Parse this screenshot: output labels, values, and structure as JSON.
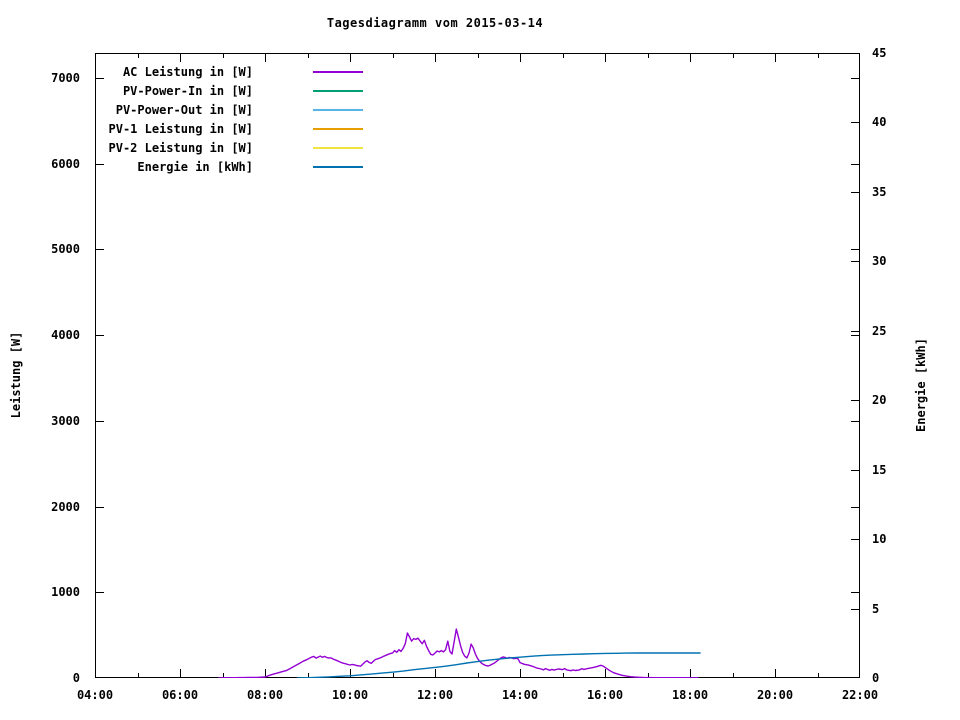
{
  "colors": {
    "text": "#000000",
    "background": "#ffffff",
    "border": "#000000"
  },
  "chart_data": {
    "type": "line",
    "title": "Tagesdiagramm vom 2015-03-14",
    "grid": false,
    "legend_position": "top-left-inside",
    "x_axis": {
      "label": "",
      "range_hours": [
        4,
        22
      ],
      "major_ticks": [
        {
          "hour": 4,
          "label": "04:00"
        },
        {
          "hour": 6,
          "label": "06:00"
        },
        {
          "hour": 8,
          "label": "08:00"
        },
        {
          "hour": 10,
          "label": "10:00"
        },
        {
          "hour": 12,
          "label": "12:00"
        },
        {
          "hour": 14,
          "label": "14:00"
        },
        {
          "hour": 16,
          "label": "16:00"
        },
        {
          "hour": 18,
          "label": "18:00"
        },
        {
          "hour": 20,
          "label": "20:00"
        },
        {
          "hour": 22,
          "label": "22:00"
        }
      ],
      "minor_tick_hours": [
        5,
        7,
        9,
        11,
        13,
        15,
        17,
        19,
        21
      ]
    },
    "y1_axis": {
      "label": "Leistung [W]",
      "range": [
        0,
        7292
      ],
      "ticks": [
        0,
        1000,
        2000,
        3000,
        4000,
        5000,
        6000,
        7000
      ]
    },
    "y2_axis": {
      "label": "Energie [kWh]",
      "range": [
        0,
        45
      ],
      "ticks": [
        0,
        5,
        10,
        15,
        20,
        25,
        30,
        35,
        40,
        45
      ]
    },
    "series": [
      {
        "name": "AC Leistung in [W]",
        "color": "#9400d3",
        "axis": "y1",
        "points": [
          [
            6.9,
            0
          ],
          [
            7.0,
            2
          ],
          [
            7.1,
            3
          ],
          [
            7.2,
            4
          ],
          [
            7.3,
            4
          ],
          [
            7.4,
            5
          ],
          [
            7.5,
            5
          ],
          [
            7.6,
            6
          ],
          [
            7.7,
            6
          ],
          [
            7.8,
            7
          ],
          [
            7.9,
            9
          ],
          [
            8.0,
            12
          ],
          [
            8.05,
            20
          ],
          [
            8.1,
            30
          ],
          [
            8.2,
            46
          ],
          [
            8.3,
            60
          ],
          [
            8.4,
            73
          ],
          [
            8.5,
            86
          ],
          [
            8.6,
            112
          ],
          [
            8.7,
            140
          ],
          [
            8.8,
            168
          ],
          [
            8.9,
            196
          ],
          [
            9.0,
            218
          ],
          [
            9.05,
            232
          ],
          [
            9.1,
            244
          ],
          [
            9.15,
            252
          ],
          [
            9.2,
            232
          ],
          [
            9.25,
            244
          ],
          [
            9.3,
            256
          ],
          [
            9.35,
            242
          ],
          [
            9.4,
            252
          ],
          [
            9.45,
            240
          ],
          [
            9.5,
            232
          ],
          [
            9.55,
            236
          ],
          [
            9.6,
            222
          ],
          [
            9.65,
            212
          ],
          [
            9.7,
            202
          ],
          [
            9.75,
            190
          ],
          [
            9.8,
            180
          ],
          [
            9.85,
            172
          ],
          [
            9.9,
            166
          ],
          [
            9.95,
            158
          ],
          [
            10.0,
            152
          ],
          [
            10.05,
            158
          ],
          [
            10.1,
            154
          ],
          [
            10.15,
            146
          ],
          [
            10.2,
            142
          ],
          [
            10.25,
            138
          ],
          [
            10.3,
            162
          ],
          [
            10.35,
            186
          ],
          [
            10.4,
            202
          ],
          [
            10.45,
            182
          ],
          [
            10.5,
            172
          ],
          [
            10.55,
            196
          ],
          [
            10.6,
            216
          ],
          [
            10.65,
            224
          ],
          [
            10.7,
            232
          ],
          [
            10.75,
            244
          ],
          [
            10.8,
            256
          ],
          [
            10.85,
            266
          ],
          [
            10.9,
            276
          ],
          [
            10.95,
            286
          ],
          [
            11.0,
            290
          ],
          [
            11.05,
            320
          ],
          [
            11.1,
            300
          ],
          [
            11.15,
            330
          ],
          [
            11.2,
            310
          ],
          [
            11.25,
            345
          ],
          [
            11.3,
            400
          ],
          [
            11.35,
            525
          ],
          [
            11.4,
            480
          ],
          [
            11.45,
            430
          ],
          [
            11.5,
            460
          ],
          [
            11.55,
            450
          ],
          [
            11.6,
            465
          ],
          [
            11.65,
            430
          ],
          [
            11.7,
            400
          ],
          [
            11.75,
            440
          ],
          [
            11.8,
            370
          ],
          [
            11.85,
            320
          ],
          [
            11.9,
            275
          ],
          [
            11.95,
            270
          ],
          [
            12.0,
            290
          ],
          [
            12.05,
            315
          ],
          [
            12.1,
            305
          ],
          [
            12.15,
            320
          ],
          [
            12.2,
            305
          ],
          [
            12.25,
            330
          ],
          [
            12.3,
            430
          ],
          [
            12.35,
            310
          ],
          [
            12.4,
            280
          ],
          [
            12.45,
            420
          ],
          [
            12.5,
            570
          ],
          [
            12.55,
            480
          ],
          [
            12.6,
            380
          ],
          [
            12.65,
            300
          ],
          [
            12.7,
            255
          ],
          [
            12.75,
            235
          ],
          [
            12.8,
            290
          ],
          [
            12.85,
            395
          ],
          [
            12.9,
            350
          ],
          [
            12.95,
            280
          ],
          [
            13.0,
            230
          ],
          [
            13.05,
            195
          ],
          [
            13.1,
            170
          ],
          [
            13.15,
            155
          ],
          [
            13.2,
            145
          ],
          [
            13.25,
            140
          ],
          [
            13.3,
            150
          ],
          [
            13.4,
            175
          ],
          [
            13.5,
            215
          ],
          [
            13.55,
            235
          ],
          [
            13.6,
            245
          ],
          [
            13.65,
            240
          ],
          [
            13.7,
            230
          ],
          [
            13.75,
            240
          ],
          [
            13.8,
            235
          ],
          [
            13.85,
            225
          ],
          [
            13.9,
            230
          ],
          [
            13.95,
            225
          ],
          [
            14.0,
            180
          ],
          [
            14.1,
            160
          ],
          [
            14.2,
            150
          ],
          [
            14.3,
            135
          ],
          [
            14.4,
            115
          ],
          [
            14.5,
            105
          ],
          [
            14.55,
            95
          ],
          [
            14.6,
            110
          ],
          [
            14.7,
            90
          ],
          [
            14.75,
            100
          ],
          [
            14.8,
            92
          ],
          [
            14.9,
            105
          ],
          [
            15.0,
            98
          ],
          [
            15.05,
            110
          ],
          [
            15.1,
            95
          ],
          [
            15.2,
            85
          ],
          [
            15.25,
            95
          ],
          [
            15.3,
            88
          ],
          [
            15.4,
            95
          ],
          [
            15.45,
            108
          ],
          [
            15.5,
            100
          ],
          [
            15.6,
            112
          ],
          [
            15.7,
            120
          ],
          [
            15.8,
            132
          ],
          [
            15.9,
            148
          ],
          [
            15.95,
            140
          ],
          [
            16.0,
            125
          ],
          [
            16.1,
            90
          ],
          [
            16.2,
            62
          ],
          [
            16.3,
            45
          ],
          [
            16.4,
            32
          ],
          [
            16.5,
            22
          ],
          [
            16.6,
            15
          ],
          [
            16.7,
            11
          ],
          [
            16.8,
            8
          ],
          [
            16.9,
            6
          ],
          [
            17.0,
            5
          ],
          [
            17.2,
            4
          ],
          [
            17.4,
            4
          ],
          [
            17.6,
            3
          ],
          [
            17.8,
            3
          ],
          [
            18.0,
            3
          ],
          [
            18.1,
            2
          ],
          [
            18.2,
            2
          ]
        ]
      },
      {
        "name": "PV-Power-In in [W]",
        "color": "#009e73",
        "axis": "y1",
        "points": []
      },
      {
        "name": "PV-Power-Out in [W]",
        "color": "#56b4e9",
        "axis": "y1",
        "points": []
      },
      {
        "name": "PV-1 Leistung in [W]",
        "color": "#e69f00",
        "axis": "y1",
        "points": []
      },
      {
        "name": "PV-2 Leistung in [W]",
        "color": "#f0e442",
        "axis": "y1",
        "points": []
      },
      {
        "name": "Energie in [kWh]",
        "color": "#0072b2",
        "axis": "y2",
        "points": [
          [
            8.75,
            0
          ],
          [
            9.0,
            0.02
          ],
          [
            9.25,
            0.05
          ],
          [
            9.5,
            0.08
          ],
          [
            9.75,
            0.12
          ],
          [
            10.0,
            0.16
          ],
          [
            10.25,
            0.22
          ],
          [
            10.5,
            0.28
          ],
          [
            10.75,
            0.35
          ],
          [
            11.0,
            0.42
          ],
          [
            11.25,
            0.5
          ],
          [
            11.5,
            0.6
          ],
          [
            11.75,
            0.68
          ],
          [
            12.0,
            0.76
          ],
          [
            12.25,
            0.85
          ],
          [
            12.5,
            0.96
          ],
          [
            12.75,
            1.08
          ],
          [
            13.0,
            1.18
          ],
          [
            13.25,
            1.28
          ],
          [
            13.5,
            1.36
          ],
          [
            13.75,
            1.44
          ],
          [
            14.0,
            1.5
          ],
          [
            14.25,
            1.56
          ],
          [
            14.5,
            1.61
          ],
          [
            14.75,
            1.65
          ],
          [
            15.0,
            1.68
          ],
          [
            15.25,
            1.71
          ],
          [
            15.5,
            1.73
          ],
          [
            15.75,
            1.75
          ],
          [
            16.0,
            1.77
          ],
          [
            16.25,
            1.78
          ],
          [
            16.5,
            1.79
          ],
          [
            16.75,
            1.8
          ],
          [
            17.0,
            1.8
          ],
          [
            17.25,
            1.8
          ],
          [
            17.5,
            1.8
          ],
          [
            17.75,
            1.8
          ],
          [
            18.0,
            1.8
          ],
          [
            18.25,
            1.8
          ]
        ]
      }
    ]
  }
}
